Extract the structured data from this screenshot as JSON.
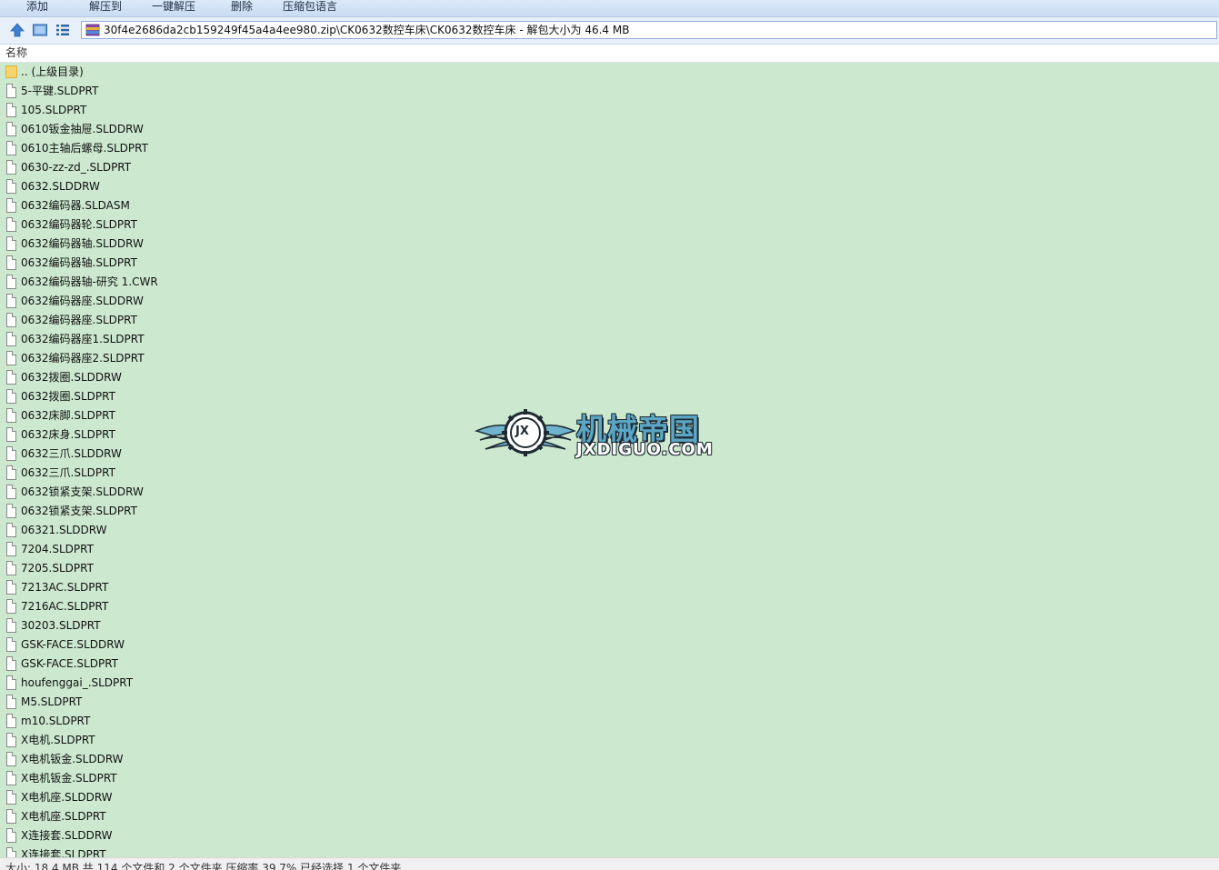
{
  "toolbar": {
    "buttons": [
      "添加",
      "解压到",
      "一键解压",
      "删除",
      "压缩包语言"
    ]
  },
  "address": {
    "path": "30f4e2686da2cb159249f45a4a4ee980.zip\\CK0632数控车床\\CK0632数控车床 - 解包大小为 46.4 MB",
    "icons": [
      "up-arrow-icon",
      "desktop-view-icon",
      "list-view-icon",
      "zip-archive-icon"
    ]
  },
  "columns": {
    "name": "名称"
  },
  "files": [
    {
      "name": ".. (上级目录)",
      "type": "folder"
    },
    {
      "name": "5-平键.SLDPRT",
      "type": "file"
    },
    {
      "name": "105.SLDPRT",
      "type": "file"
    },
    {
      "name": "0610钣金抽屉.SLDDRW",
      "type": "file"
    },
    {
      "name": "0610主轴后螺母.SLDPRT",
      "type": "file"
    },
    {
      "name": "0630-zz-zd_.SLDPRT",
      "type": "file"
    },
    {
      "name": "0632.SLDDRW",
      "type": "file"
    },
    {
      "name": "0632编码器.SLDASM",
      "type": "file"
    },
    {
      "name": "0632编码器轮.SLDPRT",
      "type": "file"
    },
    {
      "name": "0632编码器轴.SLDDRW",
      "type": "file"
    },
    {
      "name": "0632编码器轴.SLDPRT",
      "type": "file"
    },
    {
      "name": "0632编码器轴-研究 1.CWR",
      "type": "file"
    },
    {
      "name": "0632编码器座.SLDDRW",
      "type": "file"
    },
    {
      "name": "0632编码器座.SLDPRT",
      "type": "file"
    },
    {
      "name": "0632编码器座1.SLDPRT",
      "type": "file"
    },
    {
      "name": "0632编码器座2.SLDPRT",
      "type": "file"
    },
    {
      "name": "0632拨圈.SLDDRW",
      "type": "file"
    },
    {
      "name": "0632拨圈.SLDPRT",
      "type": "file"
    },
    {
      "name": "0632床脚.SLDPRT",
      "type": "file"
    },
    {
      "name": "0632床身.SLDPRT",
      "type": "file"
    },
    {
      "name": "0632三爪.SLDDRW",
      "type": "file"
    },
    {
      "name": "0632三爪.SLDPRT",
      "type": "file"
    },
    {
      "name": "0632锁紧支架.SLDDRW",
      "type": "file"
    },
    {
      "name": "0632锁紧支架.SLDPRT",
      "type": "file"
    },
    {
      "name": "06321.SLDDRW",
      "type": "file"
    },
    {
      "name": "7204.SLDPRT",
      "type": "file"
    },
    {
      "name": "7205.SLDPRT",
      "type": "file"
    },
    {
      "name": "7213AC.SLDPRT",
      "type": "file"
    },
    {
      "name": "7216AC.SLDPRT",
      "type": "file"
    },
    {
      "name": "30203.SLDPRT",
      "type": "file"
    },
    {
      "name": "GSK-FACE.SLDDRW",
      "type": "file"
    },
    {
      "name": "GSK-FACE.SLDPRT",
      "type": "file"
    },
    {
      "name": "houfenggai_.SLDPRT",
      "type": "file"
    },
    {
      "name": "M5.SLDPRT",
      "type": "file"
    },
    {
      "name": "m10.SLDPRT",
      "type": "file"
    },
    {
      "name": "X电机.SLDPRT",
      "type": "file"
    },
    {
      "name": "X电机钣金.SLDDRW",
      "type": "file"
    },
    {
      "name": "X电机钣金.SLDPRT",
      "type": "file"
    },
    {
      "name": "X电机座.SLDDRW",
      "type": "file"
    },
    {
      "name": "X电机座.SLDPRT",
      "type": "file"
    },
    {
      "name": "X连接套.SLDDRW",
      "type": "file"
    },
    {
      "name": "X连接套.SLDPRT",
      "type": "file"
    }
  ],
  "watermark": {
    "cn": "机械帝国",
    "en": "JXDIGUO.COM",
    "badge": "JX"
  },
  "status": {
    "text": "大小: 18.4 MB 共 114 个文件和 2 个文件夹 压缩率 39.7% 已经选择 1 个文件夹"
  },
  "colors": {
    "list_background": "#cce8cf",
    "toolbar_background": "#dce9f8",
    "watermark_accent": "#5ba6c4"
  }
}
